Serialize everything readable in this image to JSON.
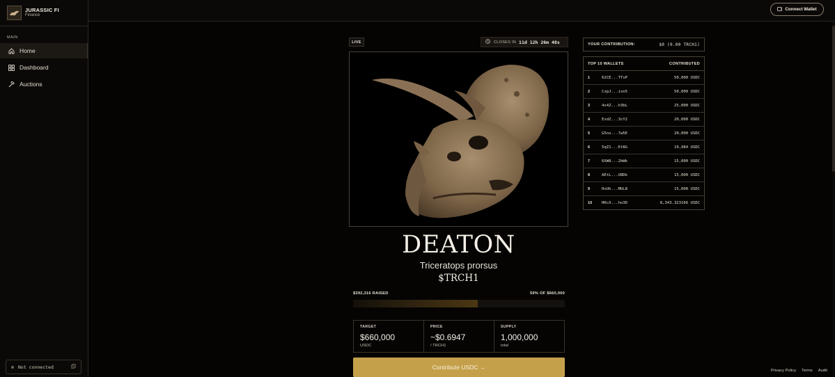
{
  "brand": {
    "name": "JURASSIC FI",
    "sub": "Finance"
  },
  "sidebar": {
    "section_label": "MAIN",
    "items": [
      {
        "label": "Home",
        "icon": "home-icon",
        "active": true
      },
      {
        "label": "Dashboard",
        "icon": "dashboard-icon",
        "active": false
      },
      {
        "label": "Auctions",
        "icon": "auctions-icon",
        "active": false
      }
    ],
    "status": "Not connected"
  },
  "topbar": {
    "connect_label": "Connect Wallet"
  },
  "auction": {
    "live_label": "LIVE",
    "closes_label": "CLOSES IN",
    "closes_time": "11d 12h 26m 48s",
    "name": "DEATON",
    "species": "Triceratops prorsus",
    "ticker": "$TRCH1",
    "raised_label": "$392,316 RAISED",
    "progress_label": "59% OF $660,000",
    "progress_fraction": 0.59,
    "stats": [
      {
        "label": "TARGET",
        "value": "$660,000",
        "unit": "USDC"
      },
      {
        "label": "PRICE",
        "value": "~$0.6947",
        "unit": "/ TRCH1"
      },
      {
        "label": "SUPPLY",
        "value": "1,000,000",
        "unit": "total"
      }
    ],
    "contribute_label": "Contribute USDC →"
  },
  "your_contribution": {
    "label": "YOUR CONTRIBUTION:",
    "value": "$0 (0.00 TRCH1)"
  },
  "wallets": {
    "header_left": "TOP 10 WALLETS",
    "header_right": "CONTRIBUTED",
    "rows": [
      {
        "rank": "1",
        "address": "62CE...TTvP",
        "amount": "50,000 USDC"
      },
      {
        "rank": "2",
        "address": "CzpJ...isn5",
        "amount": "50,000 USDC"
      },
      {
        "rank": "3",
        "address": "4s4Z...h3bL",
        "amount": "25,000 USDC"
      },
      {
        "rank": "4",
        "address": "EsdZ...3cY2",
        "amount": "20,000 USDC"
      },
      {
        "rank": "5",
        "address": "G5nx...7w5E",
        "amount": "20,000 USDC"
      },
      {
        "rank": "6",
        "address": "5qZ1...Et8G",
        "amount": "19,984 USDC"
      },
      {
        "rank": "7",
        "address": "6XW8...2bWk",
        "amount": "15,000 USDC"
      },
      {
        "rank": "8",
        "address": "AEtL...U8Dk",
        "amount": "15,000 USDC"
      },
      {
        "rank": "9",
        "address": "HxUh...MUL8",
        "amount": "15,000 USDC"
      },
      {
        "rank": "10",
        "address": "HKcX...ho3D",
        "amount": "8,343.323166 USDC"
      }
    ]
  },
  "footer": {
    "links": [
      "Privacy Policy",
      "Terms",
      "Audit"
    ]
  },
  "colors": {
    "accent": "#c4a04a",
    "background": "#050403",
    "border": "#4a4238"
  }
}
